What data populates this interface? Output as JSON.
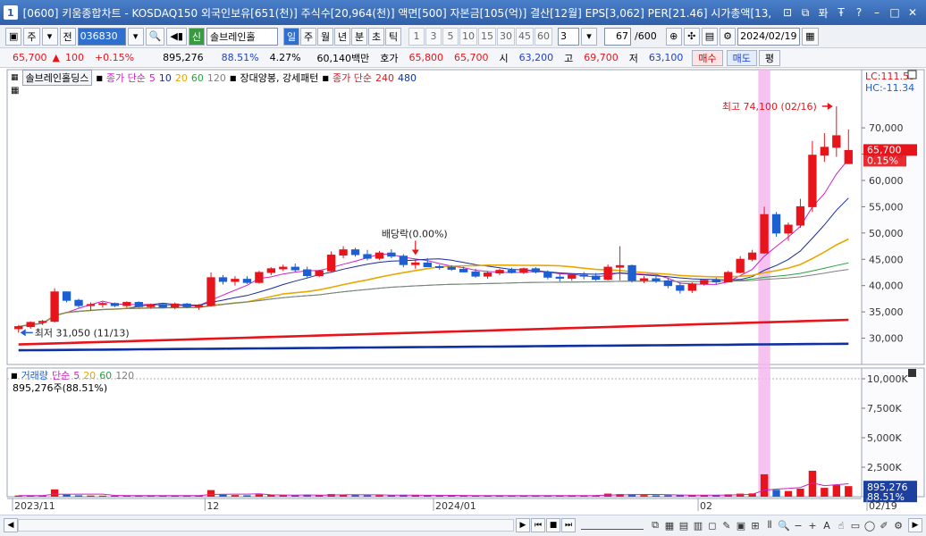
{
  "window": {
    "badge": "1",
    "title": "[0600] 키움종합차트 - KOSDAQ150 외국인보유[651(천)] 주식수[20,964(천)] 액면[500] 자본금[105(억)] 결산[12월] EPS[3,062] PER[21.46] 시가총액[13,",
    "controls": [
      "⊡",
      "⧉",
      "퐈",
      "Ŧ",
      "?",
      "–",
      "□",
      "✕"
    ]
  },
  "toolbar": {
    "mode_label": "주",
    "all_label": "전",
    "code": "036830",
    "type_label": "신",
    "stock_name": "솔브레인홀",
    "periods": [
      {
        "label": "일",
        "active": true
      },
      {
        "label": "주",
        "active": false
      },
      {
        "label": "월",
        "active": false
      },
      {
        "label": "년",
        "active": false
      },
      {
        "label": "분",
        "active": false
      },
      {
        "label": "초",
        "active": false
      },
      {
        "label": "틱",
        "active": false
      }
    ],
    "intervals": [
      "1",
      "3",
      "5",
      "10",
      "15",
      "30",
      "45",
      "60"
    ],
    "interval_value": "3",
    "count": "67",
    "count_total": "/600",
    "date": "2024/02/19"
  },
  "quote": {
    "price": "65,700",
    "change": "100",
    "change_pct": "+0.15%",
    "volume": "895,276",
    "volume_ratio": "88.51%",
    "turnover": "4.27%",
    "amount": "60,140백만",
    "hoga_label": "호가",
    "ask": "65,800",
    "bid": "65,700",
    "open_label": "시",
    "open": "63,200",
    "high_label": "고",
    "high": "69,700",
    "low_label": "저",
    "low": "63,100",
    "buy_label": "매수",
    "sell_label": "매도",
    "flat_label": "평"
  },
  "legend": {
    "stock": "솔브레인홀딩스",
    "ma_label": "종가 단순",
    "ma_periods": [
      "5",
      "10",
      "20",
      "60",
      "120"
    ],
    "pattern": "장대양봉, 강세패턴",
    "ma2_label": "종가 단순",
    "ma2_periods": [
      "240",
      "480"
    ],
    "vol_label": "거래량",
    "vol_ma_label": "단순",
    "vol_ma_periods": [
      "5",
      "20",
      "60",
      "120"
    ],
    "vol_readout": "895,276주(88.51%)"
  },
  "colors": {
    "up": "#e8141c",
    "down": "#1c5fd0",
    "ma5": "#d020c0",
    "ma10": "#1a2a9a",
    "ma20": "#e8a800",
    "ma60": "#2aa040",
    "ma120": "#808080",
    "ma240": "#e8141c",
    "ma480": "#1030a0"
  },
  "chart_data": {
    "type": "candlestick",
    "y_range": [
      25000,
      78000
    ],
    "y_ticks": [
      "70,000",
      "65,000",
      "60,000",
      "55,000",
      "50,000",
      "45,000",
      "40,000",
      "35,000",
      "30,000"
    ],
    "vol_ticks": [
      "10,000K",
      "7,500K",
      "5,000K",
      "2,500K"
    ],
    "x_labels": [
      "2023/11",
      "12",
      "2024/01",
      "02",
      "02/19"
    ],
    "lc_label": "LC:111.59",
    "hc_label": "HC:-11.34",
    "price_tag": "65,700",
    "price_tag_pct": "0.15%",
    "vol_tag": "895,276",
    "vol_tag_pct": "88.51%",
    "max_annotation": "최고 74,100 (02/16)",
    "min_annotation": "최저 31,050 (11/13)",
    "dividend_annotation": "배당락(0.00%)",
    "candles": [
      [
        31800,
        32500,
        31050,
        32200,
        100
      ],
      [
        32200,
        33200,
        31800,
        33000,
        90
      ],
      [
        33000,
        33500,
        32500,
        33200,
        80
      ],
      [
        33200,
        39500,
        33000,
        38800,
        620
      ],
      [
        38800,
        38900,
        36800,
        37200,
        180
      ],
      [
        37200,
        37500,
        35800,
        36200,
        120
      ],
      [
        36200,
        36800,
        35200,
        36400,
        100
      ],
      [
        36400,
        36900,
        35800,
        36600,
        90
      ],
      [
        36600,
        36800,
        35900,
        36200,
        80
      ],
      [
        36200,
        37000,
        35800,
        36800,
        100
      ],
      [
        36800,
        37000,
        35800,
        36000,
        90
      ],
      [
        36000,
        36600,
        35600,
        36400,
        80
      ],
      [
        36400,
        36700,
        35700,
        35900,
        90
      ],
      [
        35900,
        36800,
        35500,
        36500,
        100
      ],
      [
        36500,
        36700,
        35700,
        36000,
        90
      ],
      [
        36000,
        36500,
        35400,
        36200,
        110
      ],
      [
        36200,
        42500,
        36000,
        41500,
        560
      ],
      [
        41500,
        42000,
        40200,
        40800,
        180
      ],
      [
        40800,
        41800,
        40000,
        41200,
        140
      ],
      [
        41200,
        41800,
        40300,
        40600,
        120
      ],
      [
        40600,
        42800,
        40400,
        42500,
        200
      ],
      [
        42500,
        43500,
        42000,
        43200,
        150
      ],
      [
        43200,
        44000,
        42800,
        43500,
        120
      ],
      [
        43500,
        44200,
        42600,
        43000,
        110
      ],
      [
        43000,
        43600,
        41500,
        41900,
        160
      ],
      [
        41900,
        43000,
        41600,
        42800,
        120
      ],
      [
        42800,
        46500,
        42500,
        45800,
        220
      ],
      [
        45800,
        47500,
        45200,
        46800,
        180
      ],
      [
        46800,
        47200,
        45500,
        45900,
        140
      ],
      [
        45900,
        46800,
        44800,
        45200,
        130
      ],
      [
        45200,
        46600,
        44900,
        46200,
        120
      ],
      [
        46200,
        46900,
        45200,
        45600,
        110
      ],
      [
        45600,
        46000,
        43500,
        44000,
        160
      ],
      [
        44000,
        44800,
        43200,
        44300,
        120
      ],
      [
        44300,
        45200,
        43500,
        43600,
        110
      ],
      [
        43600,
        44000,
        43000,
        43500,
        100
      ],
      [
        43500,
        43900,
        42800,
        43100,
        90
      ],
      [
        43100,
        43600,
        42500,
        42600,
        100
      ],
      [
        42600,
        43200,
        41500,
        41800,
        110
      ],
      [
        41800,
        42800,
        41300,
        42400,
        90
      ],
      [
        42400,
        43200,
        42000,
        42900,
        90
      ],
      [
        42900,
        43400,
        42300,
        42500,
        80
      ],
      [
        42500,
        43400,
        42200,
        43200,
        90
      ],
      [
        43200,
        43500,
        42300,
        42600,
        90
      ],
      [
        42600,
        42900,
        41200,
        41600,
        110
      ],
      [
        41600,
        42200,
        40800,
        41400,
        90
      ],
      [
        41400,
        42300,
        40900,
        42000,
        120
      ],
      [
        42000,
        42600,
        41200,
        41800,
        90
      ],
      [
        41800,
        42400,
        40900,
        41200,
        110
      ],
      [
        41200,
        44000,
        41000,
        43500,
        260
      ],
      [
        43500,
        47500,
        41000,
        43800,
        220
      ],
      [
        43800,
        44000,
        40600,
        41000,
        210
      ],
      [
        41000,
        41800,
        40500,
        41300,
        140
      ],
      [
        41300,
        42000,
        40500,
        40900,
        120
      ],
      [
        40900,
        41400,
        39500,
        40000,
        130
      ],
      [
        40000,
        40600,
        38500,
        39100,
        120
      ],
      [
        39100,
        40600,
        38600,
        40300,
        140
      ],
      [
        40300,
        41200,
        40000,
        41000,
        130
      ],
      [
        41000,
        41500,
        40200,
        40700,
        130
      ],
      [
        40700,
        42800,
        40600,
        42500,
        200
      ],
      [
        42500,
        45600,
        42300,
        45000,
        260
      ],
      [
        45000,
        46800,
        44600,
        46200,
        280
      ],
      [
        46200,
        55000,
        46000,
        53500,
        1900
      ],
      [
        53500,
        54000,
        49300,
        50000,
        580
      ],
      [
        50000,
        52000,
        48500,
        51500,
        480
      ],
      [
        51500,
        56500,
        51000,
        55000,
        680
      ],
      [
        55000,
        67500,
        54000,
        64800,
        2200
      ],
      [
        64800,
        69000,
        63500,
        66300,
        750
      ],
      [
        66300,
        74100,
        64500,
        68500,
        980
      ],
      [
        63200,
        69700,
        63100,
        65700,
        895
      ]
    ]
  }
}
